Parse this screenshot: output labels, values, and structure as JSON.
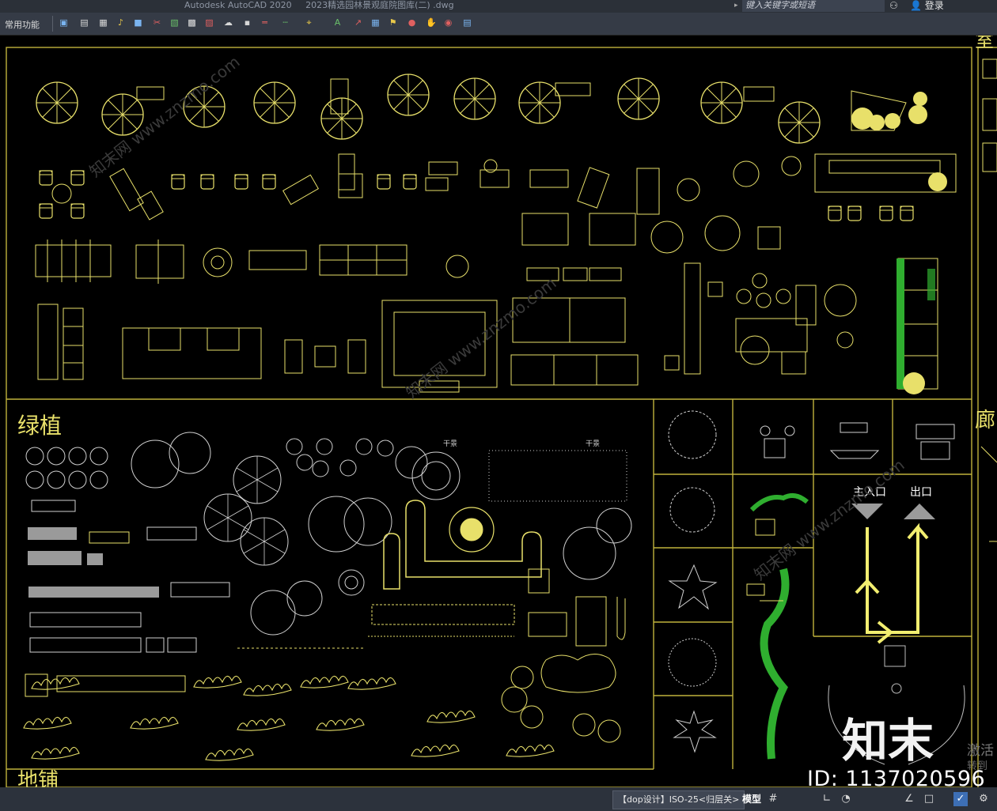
{
  "window": {
    "app_title": "Autodesk AutoCAD 2020",
    "file_name": "2023精选园林景观庭院图库(二) .dwg",
    "search_placeholder": "键入关键字或短语",
    "login_label": "登录"
  },
  "toolbar": {
    "workspace_label": "常用功能",
    "icons": [
      "save-icon",
      "print-icon",
      "layer-icon",
      "match-icon",
      "layer-state-icon",
      "select-icon",
      "grid-icon",
      "rect-icon",
      "hatch-icon",
      "cloud-icon",
      "block-icon",
      "line-icon",
      "linetype-icon",
      "dimension-icon",
      "text-icon",
      "leader-icon",
      "table-icon",
      "attribute-icon",
      "insert-icon",
      "tool-icon",
      "render-icon",
      "palette-icon"
    ]
  },
  "drawing": {
    "section_plants": "绿植",
    "section_paving": "地铺",
    "section_right_top": "室",
    "section_corridor": "廊",
    "main_entrance": "主入口",
    "exit": "出口",
    "dry_scene_1": "干景",
    "dry_scene_2": "干景"
  },
  "statusbar": {
    "annotation_style": "【dop设计】ISO-25<归层关>",
    "model_label": "模型"
  },
  "watermark": {
    "logo_text": "知末",
    "id_text": "ID: 1137020596",
    "site_text": "知末网 www.znzmo.com"
  },
  "system": {
    "activate_line1": "激活",
    "activate_line2": "转到"
  },
  "colors": {
    "cad_yellow": "#e8e06a",
    "cad_white": "#d0d0d0",
    "cad_green": "#2fae2f",
    "frame": "#bfb23c",
    "background": "#000000"
  }
}
